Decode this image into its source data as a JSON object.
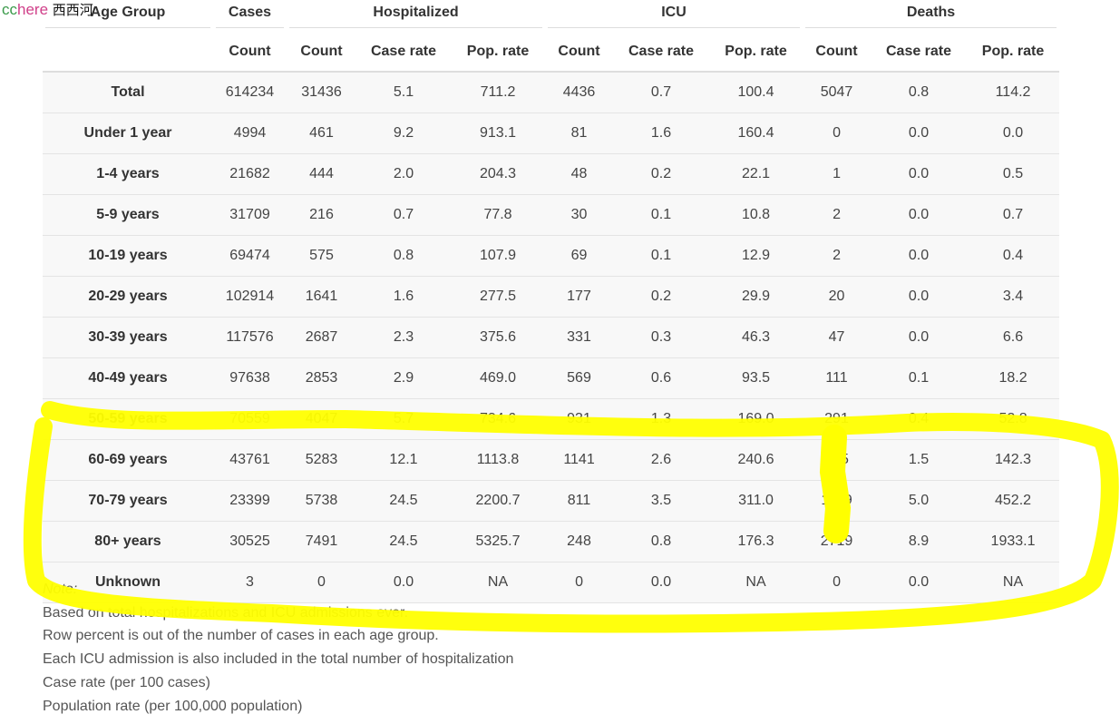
{
  "watermark": {
    "cc": "cc",
    "here": "here",
    "cn": "西西河"
  },
  "highlight_color": "#ffff00",
  "table": {
    "group_headers": [
      "Age Group",
      "Cases",
      "Hospitalized",
      "ICU",
      "Deaths"
    ],
    "sub_headers": [
      "Count",
      "Count",
      "Case rate",
      "Pop. rate",
      "Count",
      "Case rate",
      "Pop. rate",
      "Count",
      "Case rate",
      "Pop. rate"
    ],
    "rows": [
      [
        "Total",
        "614234",
        "31436",
        "5.1",
        "711.2",
        "4436",
        "0.7",
        "100.4",
        "5047",
        "0.8",
        "114.2"
      ],
      [
        "Under 1 year",
        "4994",
        "461",
        "9.2",
        "913.1",
        "81",
        "1.6",
        "160.4",
        "0",
        "0.0",
        "0.0"
      ],
      [
        "1-4 years",
        "21682",
        "444",
        "2.0",
        "204.3",
        "48",
        "0.2",
        "22.1",
        "1",
        "0.0",
        "0.5"
      ],
      [
        "5-9 years",
        "31709",
        "216",
        "0.7",
        "77.8",
        "30",
        "0.1",
        "10.8",
        "2",
        "0.0",
        "0.7"
      ],
      [
        "10-19 years",
        "69474",
        "575",
        "0.8",
        "107.9",
        "69",
        "0.1",
        "12.9",
        "2",
        "0.0",
        "0.4"
      ],
      [
        "20-29 years",
        "102914",
        "1641",
        "1.6",
        "277.5",
        "177",
        "0.2",
        "29.9",
        "20",
        "0.0",
        "3.4"
      ],
      [
        "30-39 years",
        "117576",
        "2687",
        "2.3",
        "375.6",
        "331",
        "0.3",
        "46.3",
        "47",
        "0.0",
        "6.6"
      ],
      [
        "40-49 years",
        "97638",
        "2853",
        "2.9",
        "469.0",
        "569",
        "0.6",
        "93.5",
        "111",
        "0.1",
        "18.2"
      ],
      [
        "50-59 years",
        "70559",
        "4047",
        "5.7",
        "734.6",
        "931",
        "1.3",
        "169.0",
        "291",
        "0.4",
        "52.8"
      ],
      [
        "60-69 years",
        "43761",
        "5283",
        "12.1",
        "1113.8",
        "1141",
        "2.6",
        "240.6",
        "675",
        "1.5",
        "142.3"
      ],
      [
        "70-79 years",
        "23399",
        "5738",
        "24.5",
        "2200.7",
        "811",
        "3.5",
        "311.0",
        "1179",
        "5.0",
        "452.2"
      ],
      [
        "80+ years",
        "30525",
        "7491",
        "24.5",
        "5325.7",
        "248",
        "0.8",
        "176.3",
        "2719",
        "8.9",
        "1933.1"
      ],
      [
        "Unknown",
        "3",
        "0",
        "0.0",
        "NA",
        "0",
        "0.0",
        "NA",
        "0",
        "0.0",
        "NA"
      ]
    ]
  },
  "notes": {
    "title": "Note:",
    "lines": [
      "Based on total hospitalizations and ICU admissions ever.",
      "Row percent is out of the number of cases in each age group.",
      "Each ICU admission is also included in the total number of hospitalization",
      "Case rate (per 100 cases)",
      "Population rate (per 100,000 population)"
    ]
  }
}
